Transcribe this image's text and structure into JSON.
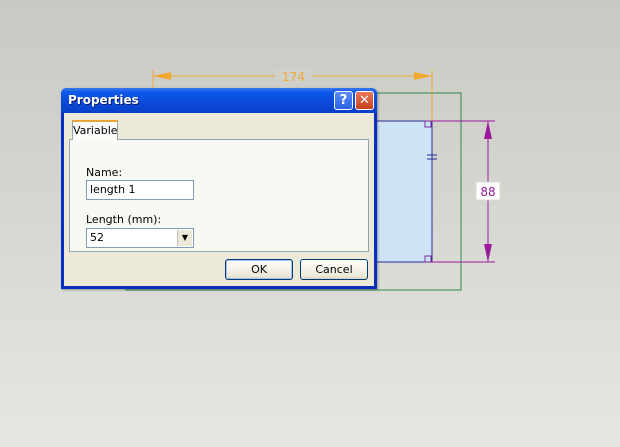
{
  "canvas": {
    "width_dimension": "174",
    "height_dimension": "88",
    "colors": {
      "dimension_orange": "#f0a830",
      "dimension_purple": "#9c1a9c",
      "outline_green": "#2e8a4e",
      "selected_fill": "#cfe3f7",
      "selected_stroke": "#2a2a9a"
    }
  },
  "dialog": {
    "title": "Properties",
    "help_label": "?",
    "close_label": "✕",
    "tab_label": "Variable",
    "name_label": "Name:",
    "name_value": "length 1",
    "length_label": "Length (mm):",
    "length_value": "52",
    "dropdown_icon": "chevron-down-icon",
    "ok_label": "OK",
    "cancel_label": "Cancel",
    "colors": {
      "titlebar": "#0a4ad8",
      "client": "#ece9d8",
      "close": "#c8401c"
    }
  }
}
